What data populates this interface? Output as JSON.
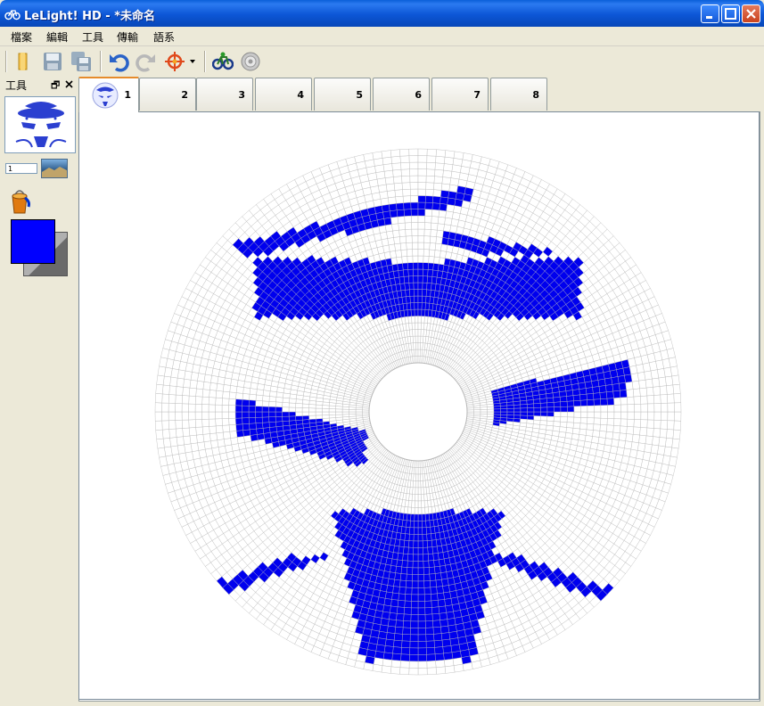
{
  "window": {
    "title": "LeLight! HD - *未命名"
  },
  "menu": [
    "檔案",
    "編輯",
    "工具",
    "傳輸",
    "語系"
  ],
  "panel": {
    "title": "工具",
    "number_value": "1"
  },
  "tabs": [
    "1",
    "2",
    "3",
    "4",
    "5",
    "6",
    "7",
    "8"
  ],
  "colors": {
    "foreground": "#0000ff",
    "background": "#b0b0b0",
    "led_on": "#0000ee",
    "grid": "#b8b8b8"
  },
  "disc": {
    "rings": 32,
    "sectors": 180
  }
}
